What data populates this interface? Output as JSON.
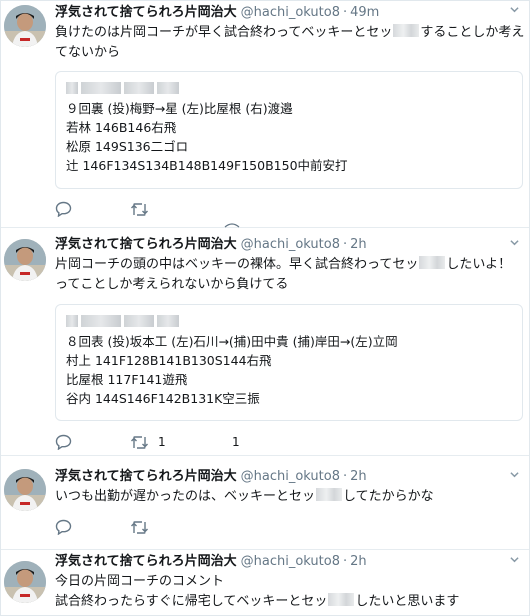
{
  "colors": {
    "text": "#14171a",
    "meta": "#657786",
    "border": "#e6ecf0",
    "icon": "#657786"
  },
  "tweets": [
    {
      "name": "浮気されて捨てられろ片岡治大",
      "handle": "@hachi_okuto8",
      "sep": "·",
      "time": "49m",
      "text_a": "負けたのは片岡コーチが早く試合終わってベッキーとセッ",
      "text_b": "することしか考え",
      "text_c": "てないから",
      "quote_lines": [
        "９回裏 (投)梅野→星 (左)比屋根 (右)渡邉",
        "若林 146B146右飛",
        "松原 149S136二ゴロ",
        "辻 146F134S134B148B149F150B150中前安打"
      ],
      "retweet_count": "",
      "like_count": ""
    },
    {
      "name": "浮気されて捨てられろ片岡治大",
      "handle": "@hachi_okuto8",
      "sep": "·",
      "time": "2h",
      "text_a": "片岡コーチの頭の中はベッキーの裸体。早く試合終わってセッ",
      "text_b": "したいよ！",
      "text_c": "ってことしか考えられないから負けてる",
      "quote_lines": [
        "８回表 (投)坂本工 (左)石川→(捕)田中貴 (捕)岸田→(左)立岡",
        "村上 141F128B141B130S144右飛",
        "比屋根 117F141遊飛",
        "谷内 144S146F142B131K空三振"
      ],
      "retweet_count": "1",
      "like_count": "1"
    },
    {
      "name": "浮気されて捨てられろ片岡治大",
      "handle": "@hachi_okuto8",
      "sep": "·",
      "time": "2h",
      "text_a": "いつも出勤が遅かったのは、ベッキーとセッ",
      "text_b": "してたからかな",
      "retweet_count": "",
      "like_count": ""
    },
    {
      "name": "浮気されて捨てられろ片岡治大",
      "handle": "@hachi_okuto8",
      "sep": "·",
      "time": "2h",
      "text_a": "今日の片岡コーチのコメント",
      "text_b": "試合終わったらすぐに帰宅してベッキーとセッ",
      "text_c": "したいと思います"
    }
  ]
}
